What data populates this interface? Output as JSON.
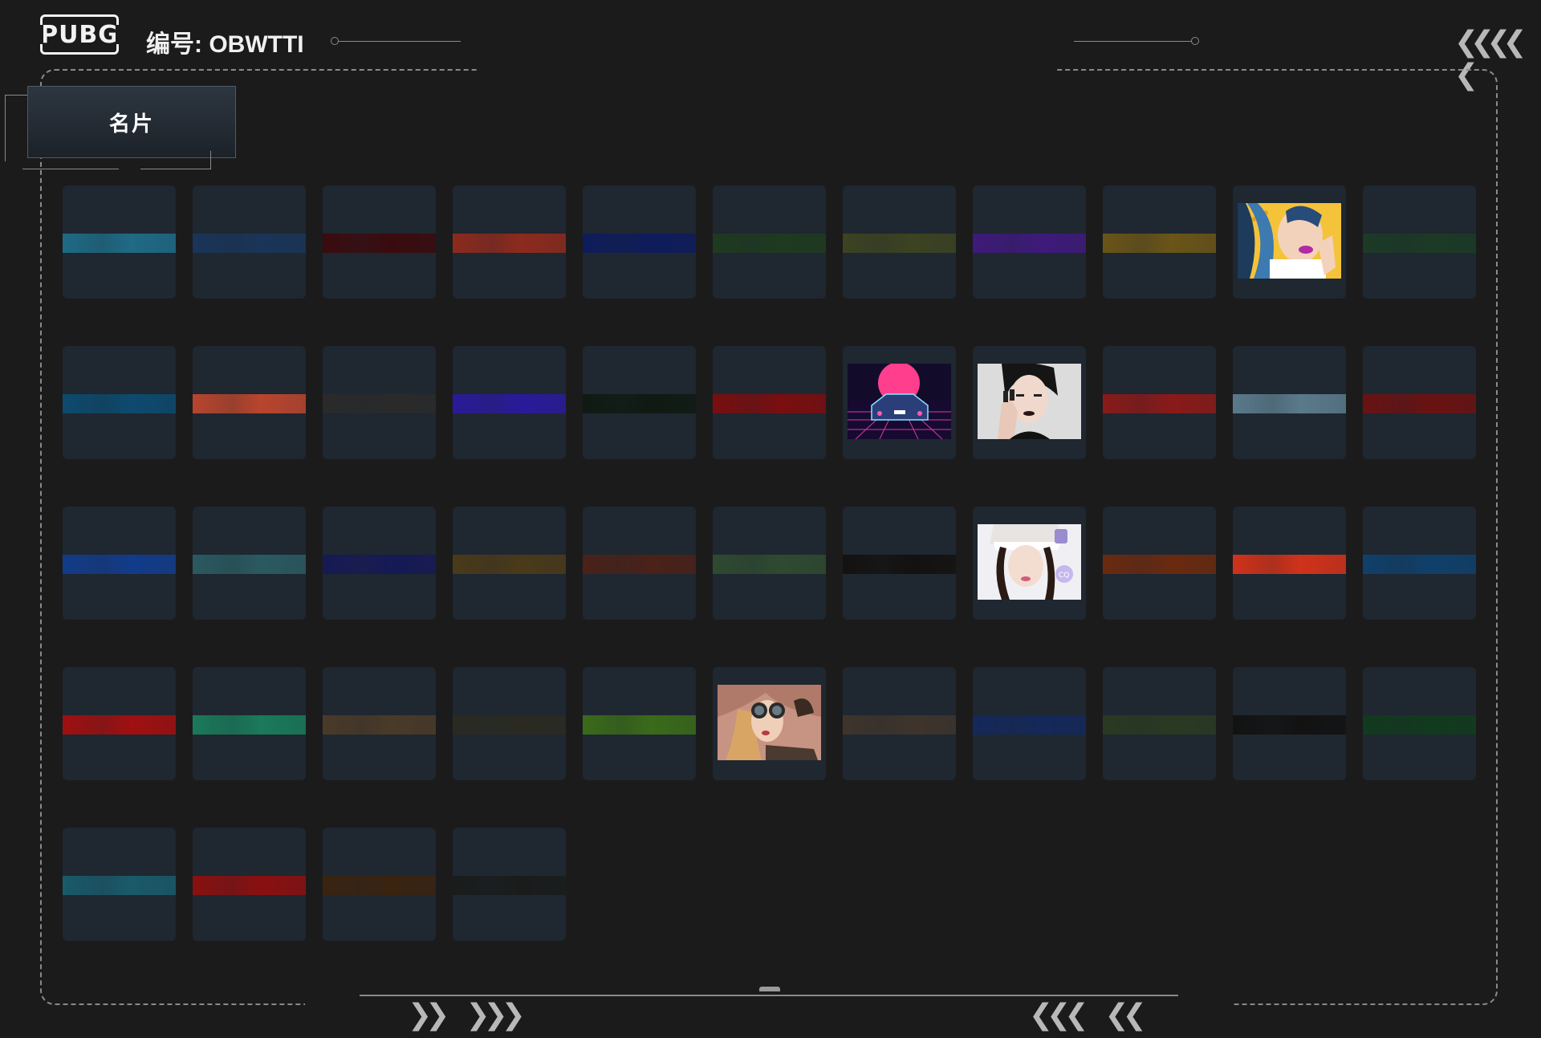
{
  "header": {
    "logo_text": "PUBG",
    "player_id": "编号: OBWTTI"
  },
  "tab": {
    "label": "名片"
  },
  "cards": [
    {
      "kind": "strip",
      "name": "card-blue-tech",
      "color": "#1f6a85"
    },
    {
      "kind": "strip",
      "name": "card-moon-phases",
      "color": "#1a3558"
    },
    {
      "kind": "strip",
      "name": "card-dark-red",
      "color": "#3a0b0e"
    },
    {
      "kind": "strip",
      "name": "card-red-letter",
      "color": "#8c2a1e"
    },
    {
      "kind": "strip",
      "name": "card-navy",
      "color": "#0e1c5c"
    },
    {
      "kind": "strip",
      "name": "card-green-camo",
      "color": "#1e3a20"
    },
    {
      "kind": "strip",
      "name": "card-olive-text",
      "color": "#3c4322"
    },
    {
      "kind": "strip",
      "name": "card-purple",
      "color": "#3e1a7a"
    },
    {
      "kind": "strip",
      "name": "card-mustard",
      "color": "#6a5418"
    },
    {
      "kind": "pic",
      "name": "card-pop-art-woman",
      "pic": "popart"
    },
    {
      "kind": "strip",
      "name": "card-dark-green",
      "color": "#1c3a26"
    },
    {
      "kind": "strip",
      "name": "card-deep-blue",
      "color": "#0d4a6e"
    },
    {
      "kind": "strip",
      "name": "card-coral",
      "color": "#b8452e"
    },
    {
      "kind": "strip",
      "name": "card-charcoal",
      "color": "#2a2a2a"
    },
    {
      "kind": "strip",
      "name": "card-indigo",
      "color": "#2a1a9a"
    },
    {
      "kind": "strip",
      "name": "card-black-dragon",
      "color": "#0f1a12"
    },
    {
      "kind": "strip",
      "name": "card-crimson",
      "color": "#7a0e10"
    },
    {
      "kind": "pic",
      "name": "card-synthwave-car",
      "pic": "synthwave"
    },
    {
      "kind": "pic",
      "name": "card-model-portrait",
      "pic": "portrait1"
    },
    {
      "kind": "strip",
      "name": "card-red-pattern",
      "color": "#8a1a1a"
    },
    {
      "kind": "strip",
      "name": "card-mountains",
      "color": "#5a7a8a"
    },
    {
      "kind": "strip",
      "name": "card-red-floral",
      "color": "#6a1212"
    },
    {
      "kind": "strip",
      "name": "card-royal-blue",
      "color": "#123c8a"
    },
    {
      "kind": "strip",
      "name": "card-teal-face",
      "color": "#2a5a60"
    },
    {
      "kind": "strip",
      "name": "card-navy-clouds",
      "color": "#161a55"
    },
    {
      "kind": "strip",
      "name": "card-brown",
      "color": "#4a3a1a"
    },
    {
      "kind": "strip",
      "name": "card-rust",
      "color": "#4a2218"
    },
    {
      "kind": "strip",
      "name": "card-forest",
      "color": "#2e4a30"
    },
    {
      "kind": "strip",
      "name": "card-black-gold",
      "color": "#141210"
    },
    {
      "kind": "pic",
      "name": "card-idol-portrait",
      "pic": "portrait2"
    },
    {
      "kind": "strip",
      "name": "card-orange-dark",
      "color": "#6a2a10"
    },
    {
      "kind": "strip",
      "name": "card-orange-red",
      "color": "#d0321a"
    },
    {
      "kind": "strip",
      "name": "card-blue-ocean",
      "color": "#10406a"
    },
    {
      "kind": "strip",
      "name": "card-scarlet",
      "color": "#a01010"
    },
    {
      "kind": "strip",
      "name": "card-green-teal",
      "color": "#1a7a5a"
    },
    {
      "kind": "strip",
      "name": "card-bronze",
      "color": "#4a3a28"
    },
    {
      "kind": "strip",
      "name": "card-dark-wings",
      "color": "#2a2a22"
    },
    {
      "kind": "strip",
      "name": "card-lime",
      "color": "#3a6a1a"
    },
    {
      "kind": "pic",
      "name": "card-goggles-woman",
      "pic": "goggles"
    },
    {
      "kind": "strip",
      "name": "card-taupe",
      "color": "#3e342c"
    },
    {
      "kind": "strip",
      "name": "card-navy-yellow",
      "color": "#14285a"
    },
    {
      "kind": "strip",
      "name": "card-shark",
      "color": "#2a3a22"
    },
    {
      "kind": "strip",
      "name": "card-black-pattern",
      "color": "#121212"
    },
    {
      "kind": "strip",
      "name": "card-green-eye",
      "color": "#123a1e"
    },
    {
      "kind": "strip",
      "name": "card-steel-blue",
      "color": "#1a5a6a"
    },
    {
      "kind": "strip",
      "name": "card-red-ornament",
      "color": "#8a1010"
    },
    {
      "kind": "strip",
      "name": "card-tiger",
      "color": "#3a2410"
    },
    {
      "kind": "strip",
      "name": "card-graphite",
      "color": "#1a1c1c"
    }
  ]
}
